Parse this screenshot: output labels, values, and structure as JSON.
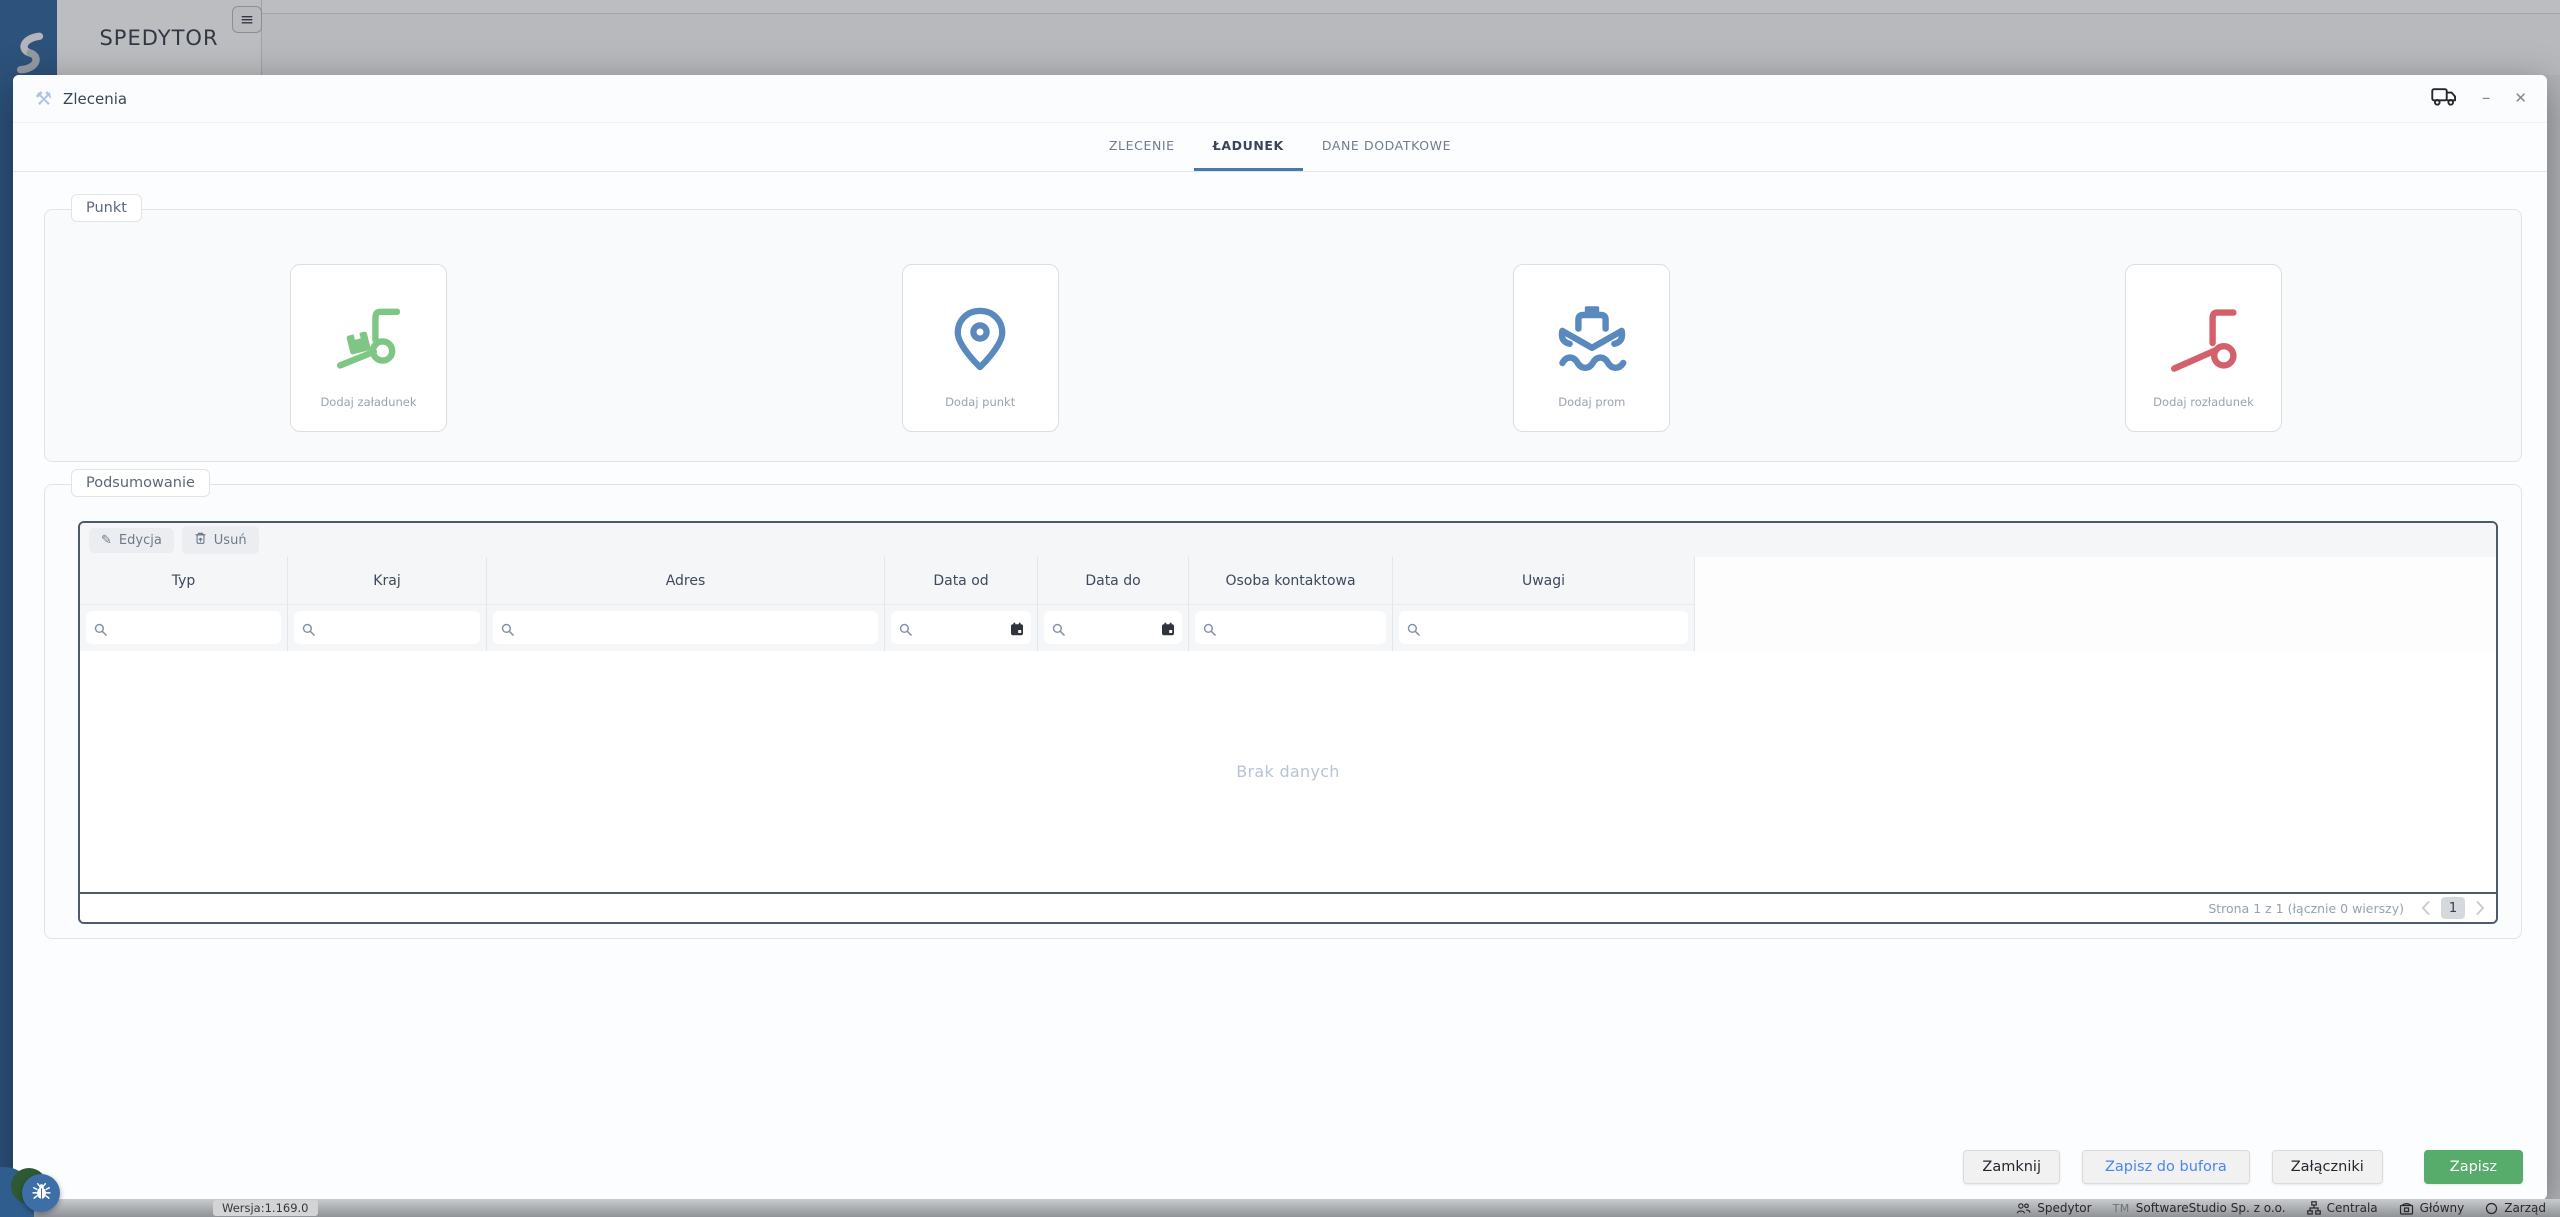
{
  "app": {
    "name": "SPEDYTOR",
    "version": "Wersja:1.169.0",
    "sidebar_color": "#33669c",
    "statusbar_items": [
      {
        "icon": "users-icon",
        "label": "Spedytor"
      },
      {
        "icon": "tm-icon",
        "label": "SoftwareStudio Sp. z o.o."
      },
      {
        "icon": "sitemap-icon",
        "label": "Centrala"
      },
      {
        "icon": "building-icon",
        "label": "Główny"
      },
      {
        "icon": "circle-icon",
        "label": "Zarząd"
      }
    ]
  },
  "dialog": {
    "title": "Zlecenia",
    "tabs": [
      {
        "label": "ZLECENIE",
        "active": false
      },
      {
        "label": "ŁADUNEK",
        "active": true
      },
      {
        "label": "DANE DODATKOWE",
        "active": false
      }
    ],
    "accent_color": "#4878ad",
    "punkt": {
      "legend": "Punkt",
      "cards": [
        {
          "label": "Dodaj załadunek",
          "icon": "loading-trolley-icon",
          "color": "#7ec683"
        },
        {
          "label": "Dodaj punkt",
          "icon": "map-pin-icon",
          "color": "#5a89bd"
        },
        {
          "label": "Dodaj prom",
          "icon": "ferry-icon",
          "color": "#5a89bd"
        },
        {
          "label": "Dodaj rozładunek",
          "icon": "unloading-trolley-icon",
          "color": "#d4606c"
        }
      ]
    },
    "summary": {
      "legend": "Podsumowanie",
      "toolbar": {
        "edit_label": "Edycja",
        "delete_label": "Usuń"
      },
      "columns": [
        {
          "label": "Typ",
          "filter": "text"
        },
        {
          "label": "Kraj",
          "filter": "text"
        },
        {
          "label": "Adres",
          "filter": "text"
        },
        {
          "label": "Data od",
          "filter": "date"
        },
        {
          "label": "Data do",
          "filter": "date"
        },
        {
          "label": "Osoba kontaktowa",
          "filter": "text"
        },
        {
          "label": "Uwagi",
          "filter": "text"
        }
      ],
      "rows": [],
      "empty_text": "Brak danych",
      "pagination": {
        "info": "Strona 1 z 1 (łącznie 0 wierszy)",
        "page": "1"
      }
    },
    "actions": {
      "close_label": "Zamknij",
      "buffer_label": "Zapisz do bufora",
      "attachments_label": "Załączniki",
      "save_label": "Zapisz",
      "save_color": "#57ac6c",
      "buffer_text_color": "#4b86f5"
    }
  }
}
